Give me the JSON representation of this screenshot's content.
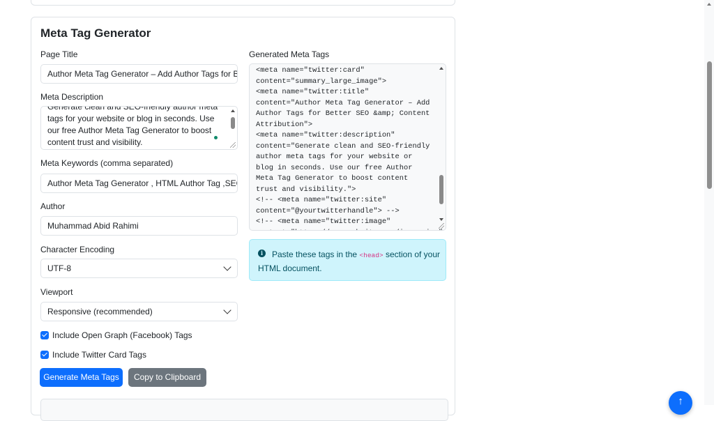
{
  "card": {
    "title": "Meta Tag Generator"
  },
  "form": {
    "page_title_label": "Page Title",
    "page_title_value": "Author Meta Tag Generator – Add Author Tags for Be",
    "meta_description_label": "Meta Description",
    "meta_description_value": "Generate clean and SEO-friendly author meta tags for your website or blog in seconds. Use our free Author Meta Tag Generator to boost content trust and visibility.",
    "meta_keywords_label": "Meta Keywords (comma separated)",
    "meta_keywords_value": "Author Meta Tag Generator , HTML Author Tag  ,SEO",
    "author_label": "Author",
    "author_value": "Muhammad Abid Rahimi",
    "encoding_label": "Character Encoding",
    "encoding_value": "UTF-8",
    "viewport_label": "Viewport",
    "viewport_value": "Responsive (recommended)",
    "og_checkbox_label": "Include Open Graph (Facebook) Tags",
    "og_checked": true,
    "twitter_checkbox_label": "Include Twitter Card Tags",
    "twitter_checked": true
  },
  "actions": {
    "generate_label": "Generate Meta Tags",
    "copy_label": "Copy to Clipboard"
  },
  "output": {
    "label": "Generated Meta Tags",
    "code": "<meta name=\"twitter:card\"\ncontent=\"summary_large_image\">\n<meta name=\"twitter:title\"\ncontent=\"Author Meta Tag Generator – Add\nAuthor Tags for Better SEO &amp; Content\nAttribution\">\n<meta name=\"twitter:description\"\ncontent=\"Generate clean and SEO-friendly\nauthor meta tags for your website or\nblog in seconds. Use our free Author\nMeta Tag Generator to boost content\ntrust and visibility.\">\n<!-- <meta name=\"twitter:site\"\ncontent=\"@yourtwitterhandle\"> -->\n<!-- <meta name=\"twitter:image\"\ncontent=\"https://yourwebsite.com/image.jpg\">"
  },
  "alert": {
    "text_before": "Paste these tags in the ",
    "code": "<head>",
    "text_after": " section of your HTML document.",
    "icon": "info-circle-icon"
  },
  "colors": {
    "primary": "#0d6efd",
    "secondary": "#6c757d",
    "info_bg": "#cff4fc",
    "info_text": "#055160"
  }
}
